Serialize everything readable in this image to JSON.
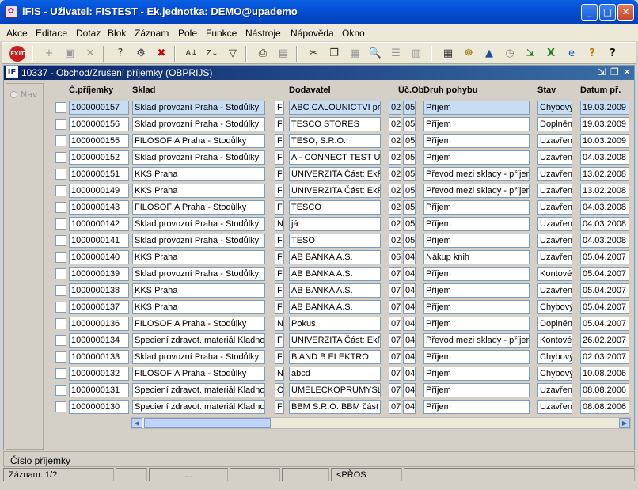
{
  "window": {
    "app": "iFIS",
    "title": "iFIS - Uživatel: FISTEST - Ek.jednotka: DEMO@upademo"
  },
  "menu": [
    "Akce",
    "Editace",
    "Dotaz",
    "Blok",
    "Záznam",
    "Pole",
    "Funkce",
    "Nástroje",
    "Nápověda",
    "Okno"
  ],
  "toolbar_icons": [
    "exit-icon",
    "insert-record-icon",
    "save-icon",
    "delete-icon",
    "enter-query-icon",
    "execute-query-icon",
    "cancel-query-icon",
    "sort-asc-icon",
    "sort-desc-icon",
    "filter-icon",
    "print-icon",
    "print-preview-icon",
    "cut-icon",
    "copy-icon",
    "paste-icon",
    "find-icon",
    "list-icon",
    "columns-icon",
    "calculator-icon",
    "settings-icon",
    "chart-icon",
    "clock-icon",
    "export-icon",
    "excel-icon",
    "web-icon",
    "help-icon",
    "context-help-icon"
  ],
  "inner": {
    "id": "10337",
    "title": "10337 - Obchod/Zrušení příjemky (OBPRIJS)"
  },
  "nav": {
    "label": "Nav"
  },
  "columns": {
    "cislo": "Č.příjemky",
    "sklad": "Sklad",
    "dodavatel": "Dodavatel",
    "ucob": "Úč.Ob",
    "druh": "Druh pohybu",
    "stav": "Stav",
    "datum": "Datum př."
  },
  "rows": [
    {
      "cislo": "1000000157",
      "sklad": "Sklad provozní Praha - Stodůlky",
      "t": "F",
      "dod": "ABC CALOUNICTVI pro",
      "uc": "02",
      "ob": "05",
      "druh": "Příjem",
      "stav": "Chybový",
      "datum": "19.03.2009"
    },
    {
      "cislo": "1000000156",
      "sklad": "Sklad provozní Praha - Stodůlky",
      "t": "F",
      "dod": "TESCO STORES",
      "uc": "02",
      "ob": "05",
      "druh": "Příjem",
      "stav": "Doplněn",
      "datum": "19.03.2009"
    },
    {
      "cislo": "1000000155",
      "sklad": "FILOSOFIA Praha - Stodůlky",
      "t": "F",
      "dod": "TESO, S.R.O.",
      "uc": "02",
      "ob": "05",
      "druh": "Příjem",
      "stav": "Uzavřen",
      "datum": "10.03.2009"
    },
    {
      "cislo": "1000000152",
      "sklad": "Sklad provozní Praha - Stodůlky",
      "t": "F",
      "dod": "A - CONNECT TEST UN",
      "uc": "02",
      "ob": "05",
      "druh": "Příjem",
      "stav": "Uzavřen",
      "datum": "04.03.2008"
    },
    {
      "cislo": "1000000151",
      "sklad": "KKS Praha",
      "t": "F",
      "dod": "UNIVERZITA Část: EkF",
      "uc": "02",
      "ob": "05",
      "druh": "Převod mezi sklady - příjem",
      "stav": "Uzavřen",
      "datum": "13.02.2008"
    },
    {
      "cislo": "1000000149",
      "sklad": "KKS Praha",
      "t": "F",
      "dod": "UNIVERZITA Část: EkF",
      "uc": "02",
      "ob": "05",
      "druh": "Převod mezi sklady - příjem",
      "stav": "Uzavřen",
      "datum": "13.02.2008"
    },
    {
      "cislo": "1000000143",
      "sklad": "FILOSOFIA Praha - Stodůlky",
      "t": "F",
      "dod": "TESCO",
      "uc": "02",
      "ob": "05",
      "druh": "Příjem",
      "stav": "Uzavřen",
      "datum": "04.03.2008"
    },
    {
      "cislo": "1000000142",
      "sklad": "Sklad provozní Praha - Stodůlky",
      "t": "N",
      "dod": "já",
      "uc": "02",
      "ob": "05",
      "druh": "Příjem",
      "stav": "Uzavřen",
      "datum": "04.03.2008"
    },
    {
      "cislo": "1000000141",
      "sklad": "Sklad provozní Praha - Stodůlky",
      "t": "F",
      "dod": " TESO",
      "uc": "02",
      "ob": "05",
      "druh": "Příjem",
      "stav": "Uzavřen",
      "datum": "04.03.2008"
    },
    {
      "cislo": "1000000140",
      "sklad": "KKS Praha",
      "t": "F",
      "dod": "AB BANKA A.S.",
      "uc": "06",
      "ob": "04",
      "druh": "Nákup knih",
      "stav": "Uzavřen",
      "datum": "05.04.2007"
    },
    {
      "cislo": "1000000139",
      "sklad": "Sklad provozní Praha - Stodůlky",
      "t": "F",
      "dod": "AB BANKA A.S.",
      "uc": "07",
      "ob": "04",
      "druh": "Příjem",
      "stav": "Kontové",
      "datum": "05.04.2007"
    },
    {
      "cislo": "1000000138",
      "sklad": "KKS Praha",
      "t": "F",
      "dod": "AB BANKA A.S.",
      "uc": "07",
      "ob": "04",
      "druh": "Příjem",
      "stav": "Uzavřen",
      "datum": "05.04.2007"
    },
    {
      "cislo": "1000000137",
      "sklad": "KKS Praha",
      "t": "F",
      "dod": "AB BANKA A.S.",
      "uc": "07",
      "ob": "04",
      "druh": "Příjem",
      "stav": "Chybový",
      "datum": "05.04.2007"
    },
    {
      "cislo": "1000000136",
      "sklad": "FILOSOFIA Praha - Stodůlky",
      "t": "N",
      "dod": "Pokus",
      "uc": "07",
      "ob": "04",
      "druh": "Příjem",
      "stav": "Doplněn",
      "datum": "05.04.2007"
    },
    {
      "cislo": "1000000134",
      "sklad": "Speciení zdravot. materiál Kladno",
      "t": "F",
      "dod": "UNIVERZITA Část: EkF",
      "uc": "07",
      "ob": "04",
      "druh": "Převod mezi sklady - příjem",
      "stav": "Kontové",
      "datum": "26.02.2007"
    },
    {
      "cislo": "1000000133",
      "sklad": "Sklad provozní Praha - Stodůlky",
      "t": "F",
      "dod": "B AND B ELEKTRO",
      "uc": "07",
      "ob": "04",
      "druh": "Příjem",
      "stav": "Chybový",
      "datum": "02.03.2007"
    },
    {
      "cislo": "1000000132",
      "sklad": "FILOSOFIA Praha - Stodůlky",
      "t": "N",
      "dod": "abcd",
      "uc": "07",
      "ob": "04",
      "druh": "Příjem",
      "stav": "Chybový",
      "datum": "10.08.2006"
    },
    {
      "cislo": "1000000131",
      "sklad": "Speciení zdravot. materiál Kladno",
      "t": "O",
      "dod": "UMELECKOPRUMYSLC",
      "uc": "07",
      "ob": "04",
      "druh": "Příjem",
      "stav": "Uzavřen",
      "datum": "08.08.2006"
    },
    {
      "cislo": "1000000130",
      "sklad": "Speciení zdravot. materiál Kladno",
      "t": "F",
      "dod": "BBM S.R.O. BBM část",
      "uc": "07",
      "ob": "04",
      "druh": "Příjem",
      "stav": "Uzavřen",
      "datum": "08.08.2006"
    }
  ],
  "status": {
    "field": "Číslo příjemky",
    "record": "Záznam: 1/?",
    "dots": "...",
    "mode": "<PŘOS"
  }
}
